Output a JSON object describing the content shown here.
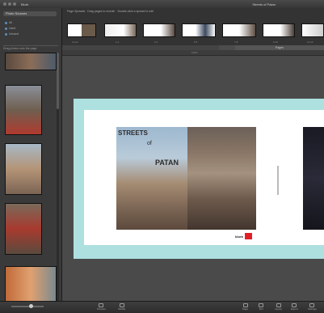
{
  "titlebar": {
    "app": "Blurb",
    "window": "Streets of Patan"
  },
  "sidebar": {
    "header": "Photo Sources",
    "options": [
      "All",
      "Used",
      "Unused"
    ],
    "sub": "Drag photos onto the page"
  },
  "strip": {
    "caption": "Page Spreads · Drag pages to reorder · Double-click a spread to edit",
    "numbers": [
      "Cover",
      "1-2",
      "3-4",
      "5-6",
      "7-8",
      "9-10",
      "11-12"
    ]
  },
  "tab": {
    "label": "Pages"
  },
  "ruler": {
    "label": "100%"
  },
  "spread": {
    "title1": "STREETS",
    "title2": "of",
    "title3": "PATAN",
    "logo": "blurb"
  },
  "bottom": {
    "items": [
      "Preview",
      "Shuffle",
      "Page",
      "Text",
      "Layout",
      "Export",
      "Settings"
    ]
  }
}
